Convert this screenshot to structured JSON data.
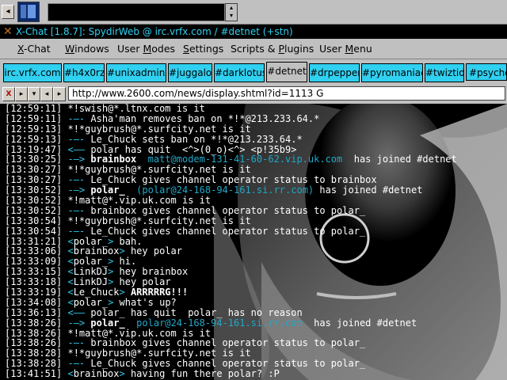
{
  "taskbar": {
    "left_arrow": "◂",
    "scroll_up": "▴",
    "scroll_down": "▾"
  },
  "window": {
    "title": "X-Chat [1.8.7]: SpydirWeb @ irc.vrfx.com / #detnet (+stn)"
  },
  "menu": [
    {
      "label": "X-Chat",
      "underline": "X"
    },
    {
      "label": "Windows",
      "underline": "W"
    },
    {
      "label": "User Modes",
      "underline": "M"
    },
    {
      "label": "Settings",
      "underline": "S"
    },
    {
      "label": "Scripts & Plugins",
      "underline": "P"
    },
    {
      "label": "User Menu",
      "underline": "M"
    }
  ],
  "tabs": [
    {
      "label": "irc.vrfx.com",
      "active": false
    },
    {
      "label": "#h4x0rz",
      "active": false
    },
    {
      "label": "#unixadminz",
      "active": false
    },
    {
      "label": "#juggalo",
      "active": false
    },
    {
      "label": "#darklotus",
      "active": false
    },
    {
      "label": "#detnet",
      "active": true
    },
    {
      "label": "#drpepper",
      "active": false
    },
    {
      "label": "#pyromaniac",
      "active": false
    },
    {
      "label": "#twiztid",
      "active": false
    },
    {
      "label": "#psycho",
      "active": false
    }
  ],
  "topic": {
    "value": "http://www.2600.com/news/display.shtml?id=1113 G",
    "buttons": [
      "X",
      "▸",
      "▾",
      "◂",
      "▸"
    ]
  },
  "colors": {
    "chrome": "#c0c0c0",
    "tab_cyan": "#30d0f0",
    "chat_bg": "#000000",
    "text_cyan": "#30c8e8"
  },
  "chat": [
    {
      "ts": "[12:59:11]",
      "parts": [
        {
          "t": " *!swish@*.ltnx.com is it",
          "c": "c-white"
        }
      ]
    },
    {
      "ts": "[12:59:11]",
      "parts": [
        {
          "t": " -—- ",
          "c": "c-cyan"
        },
        {
          "t": "Asha'man removes ban on *!*@213.233.64.*",
          "c": "c-white"
        }
      ]
    },
    {
      "ts": "[12:59:13]",
      "parts": [
        {
          "t": " *!*guybrush@*.surfcity.net is it",
          "c": "c-white"
        }
      ]
    },
    {
      "ts": "[12:59:13]",
      "parts": [
        {
          "t": " -—- ",
          "c": "c-cyan"
        },
        {
          "t": "Le_Chuck sets ban on *!*@213.233.64.*",
          "c": "c-white"
        }
      ]
    },
    {
      "ts": "[13:19:47]",
      "parts": [
        {
          "t": " <—— ",
          "c": "c-cyan"
        },
        {
          "t": "polar has quit  <^>(0_o)<^> <p!35b9>",
          "c": "c-white"
        }
      ]
    },
    {
      "ts": "[13:30:25]",
      "parts": [
        {
          "t": " -—> ",
          "c": "c-cyan"
        },
        {
          "t": "brainbox",
          "c": "c-bold"
        },
        {
          "t": "  matt@modem-131-41-60-62.vip.uk.com",
          "c": "c-teal"
        },
        {
          "t": "  has joined #detnet",
          "c": "c-white"
        }
      ]
    },
    {
      "ts": "[13:30:27]",
      "parts": [
        {
          "t": " *!*guybrush@*.surfcity.net is it",
          "c": "c-white"
        }
      ]
    },
    {
      "ts": "[13:30:27]",
      "parts": [
        {
          "t": " -—- ",
          "c": "c-cyan"
        },
        {
          "t": "Le_Chuck gives channel operator status to brainbox",
          "c": "c-white"
        }
      ]
    },
    {
      "ts": "[13:30:52]",
      "parts": [
        {
          "t": " -—> ",
          "c": "c-cyan"
        },
        {
          "t": "polar_",
          "c": "c-bold"
        },
        {
          "t": "  (polar@24-168-94-161.si.rr.com)",
          "c": "c-teal"
        },
        {
          "t": " has joined #detnet",
          "c": "c-white"
        }
      ]
    },
    {
      "ts": "[13:30:52]",
      "parts": [
        {
          "t": " *!matt@*.vip.uk.com is it",
          "c": "c-white"
        }
      ]
    },
    {
      "ts": "[13:30:52]",
      "parts": [
        {
          "t": " -—- ",
          "c": "c-cyan"
        },
        {
          "t": "brainbox gives channel operator status to polar_",
          "c": "c-white"
        }
      ]
    },
    {
      "ts": "[13:30:54]",
      "parts": [
        {
          "t": " *!*guybrush@*.surfcity.net is it",
          "c": "c-white"
        }
      ]
    },
    {
      "ts": "[13:30:54]",
      "parts": [
        {
          "t": " -—- ",
          "c": "c-cyan"
        },
        {
          "t": "Le_Chuck gives channel operator status to polar_",
          "c": "c-white"
        }
      ]
    },
    {
      "ts": "[13:31:21]",
      "parts": [
        {
          "t": " <",
          "c": "c-cyan"
        },
        {
          "t": "polar_",
          "c": "c-nick"
        },
        {
          "t": ">",
          "c": "c-cyan"
        },
        {
          "t": " bah.",
          "c": "c-white"
        }
      ]
    },
    {
      "ts": "[13:33:06]",
      "parts": [
        {
          "t": " <",
          "c": "c-cyan"
        },
        {
          "t": "brainbox",
          "c": "c-nick"
        },
        {
          "t": ">",
          "c": "c-cyan"
        },
        {
          "t": " hey polar",
          "c": "c-white"
        }
      ]
    },
    {
      "ts": "[13:33:09]",
      "parts": [
        {
          "t": " <",
          "c": "c-cyan"
        },
        {
          "t": "polar_",
          "c": "c-nick"
        },
        {
          "t": ">",
          "c": "c-cyan"
        },
        {
          "t": " hi.",
          "c": "c-white"
        }
      ]
    },
    {
      "ts": "[13:33:15]",
      "parts": [
        {
          "t": " <",
          "c": "c-cyan"
        },
        {
          "t": "LinkDJ",
          "c": "c-nick"
        },
        {
          "t": ">",
          "c": "c-cyan"
        },
        {
          "t": " hey brainbox",
          "c": "c-white"
        }
      ]
    },
    {
      "ts": "[13:33:18]",
      "parts": [
        {
          "t": " <",
          "c": "c-cyan"
        },
        {
          "t": "LinkDJ",
          "c": "c-nick"
        },
        {
          "t": ">",
          "c": "c-cyan"
        },
        {
          "t": " hey polar",
          "c": "c-white"
        }
      ]
    },
    {
      "ts": "[13:33:19]",
      "parts": [
        {
          "t": " <",
          "c": "c-cyan"
        },
        {
          "t": "Le_Chuck",
          "c": "c-nick"
        },
        {
          "t": ">",
          "c": "c-cyan"
        },
        {
          "t": " ARRRRRG!!!",
          "c": "c-bold"
        }
      ]
    },
    {
      "ts": "[13:34:08]",
      "parts": [
        {
          "t": " <",
          "c": "c-cyan"
        },
        {
          "t": "polar_",
          "c": "c-nick"
        },
        {
          "t": ">",
          "c": "c-cyan"
        },
        {
          "t": " what's up?",
          "c": "c-white"
        }
      ]
    },
    {
      "ts": "[13:36:13]",
      "parts": [
        {
          "t": " <—— ",
          "c": "c-cyan"
        },
        {
          "t": "polar_ has quit  polar_ has no reason",
          "c": "c-white"
        }
      ]
    },
    {
      "ts": "[13:38:26]",
      "parts": [
        {
          "t": " -—> ",
          "c": "c-cyan"
        },
        {
          "t": "polar_",
          "c": "c-bold"
        },
        {
          "t": "  polar@24-168-94-161.si.rr.com",
          "c": "c-teal"
        },
        {
          "t": "  has joined #detnet",
          "c": "c-white"
        }
      ]
    },
    {
      "ts": "[13:38:26]",
      "parts": [
        {
          "t": " *!matt@*.vip.uk.com is it",
          "c": "c-white"
        }
      ]
    },
    {
      "ts": "[13:38:26]",
      "parts": [
        {
          "t": " -—- ",
          "c": "c-cyan"
        },
        {
          "t": "brainbox gives channel operator status to polar_",
          "c": "c-white"
        }
      ]
    },
    {
      "ts": "[13:38:28]",
      "parts": [
        {
          "t": " *!*guybrush@*.surfcity.net is it",
          "c": "c-white"
        }
      ]
    },
    {
      "ts": "[13:38:28]",
      "parts": [
        {
          "t": " -—- ",
          "c": "c-cyan"
        },
        {
          "t": "Le_Chuck gives channel operator status to polar_",
          "c": "c-white"
        }
      ]
    },
    {
      "ts": "[13:41:51]",
      "parts": [
        {
          "t": " <",
          "c": "c-cyan"
        },
        {
          "t": "brainbox",
          "c": "c-nick"
        },
        {
          "t": ">",
          "c": "c-cyan"
        },
        {
          "t": " having fun there polar? :P",
          "c": "c-white"
        }
      ]
    }
  ]
}
